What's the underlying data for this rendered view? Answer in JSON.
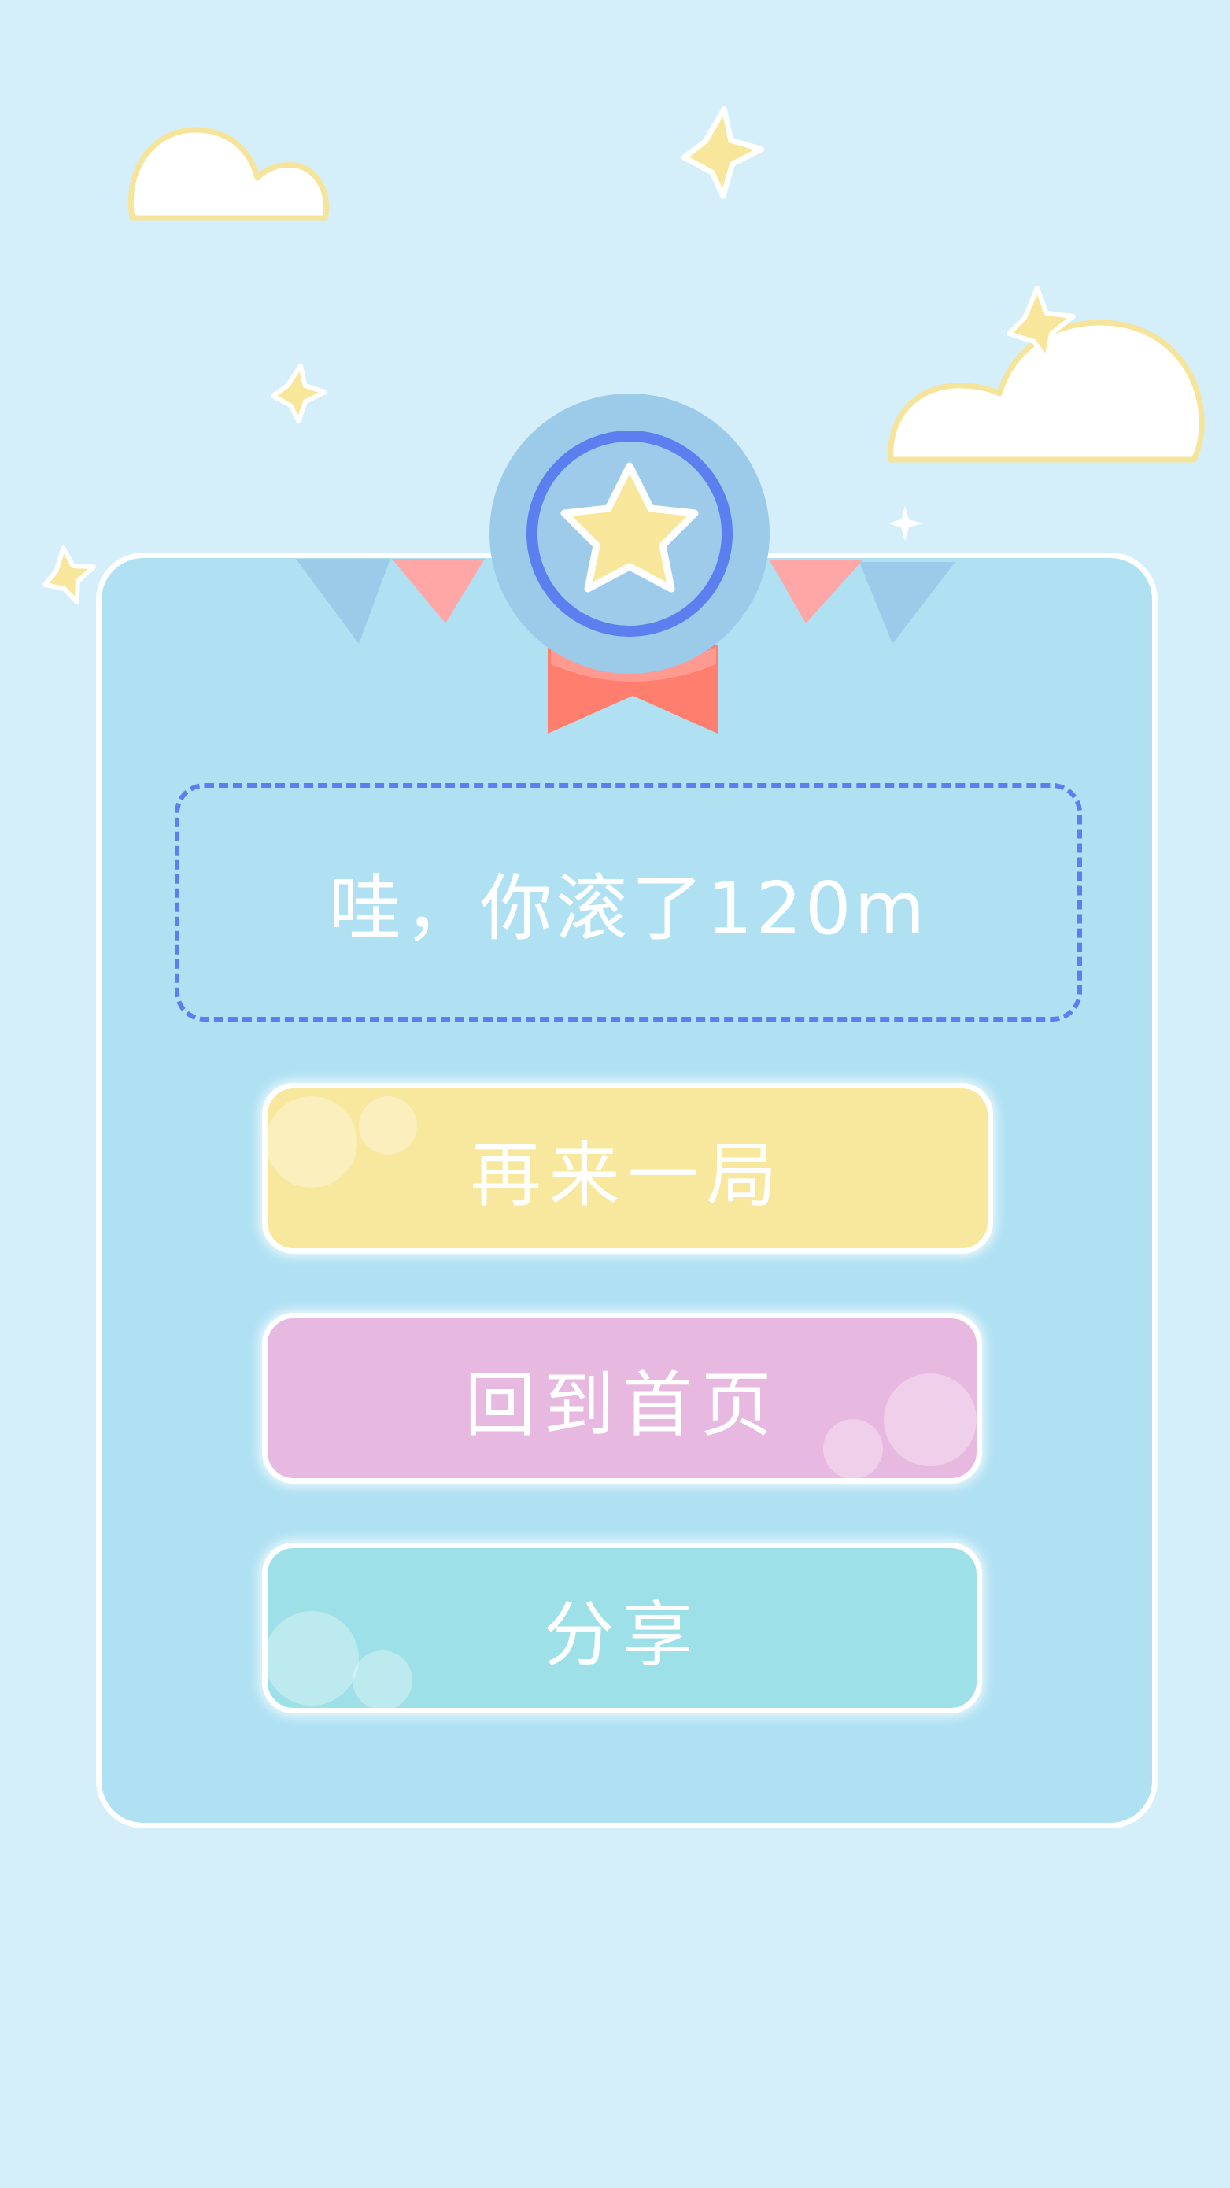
{
  "result": {
    "message": "哇，你滚了120m"
  },
  "buttons": {
    "replay_label": "再来一局",
    "home_label": "回到首页",
    "share_label": "分享"
  },
  "icons": {
    "medal": "star-medal-icon",
    "clouds": "cloud-icon",
    "stars": "sparkle-star-icon"
  },
  "colors": {
    "background": "#d4eefa",
    "card": "#afe1f3",
    "score_border": "#5b7fef",
    "replay_button": "#f8e89e",
    "home_button": "#e8b9e0",
    "share_button": "#9de0e8",
    "medal_ribbon": "#ff7e6e",
    "star_fill": "#f8e69a"
  }
}
